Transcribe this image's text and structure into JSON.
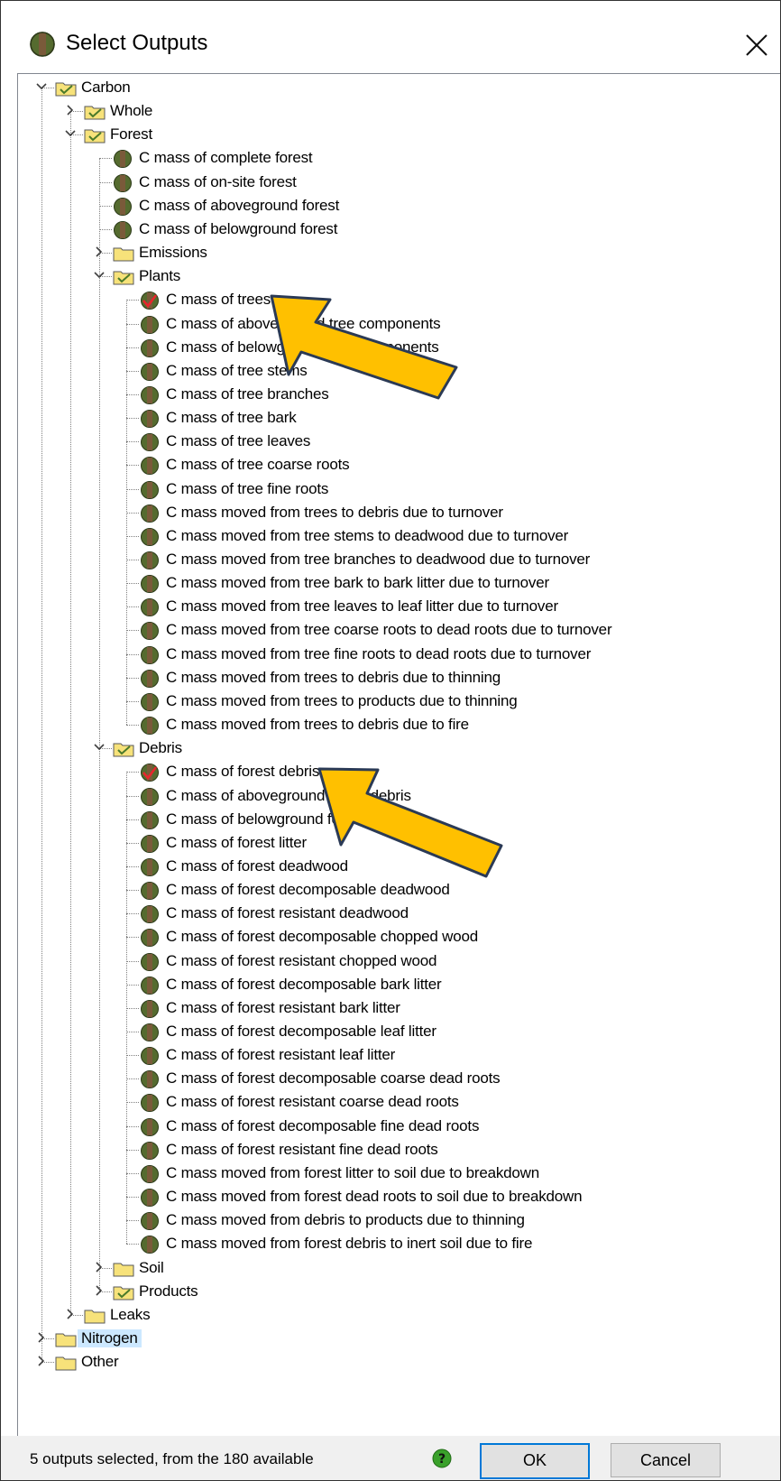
{
  "window": {
    "title": "Select Outputs",
    "icons": {
      "title": "pool-icon",
      "close": "close-icon"
    }
  },
  "tree": {
    "rows": [
      {
        "label": "Carbon",
        "depth": 0,
        "type": "folder",
        "state": "expanded",
        "checked": true
      },
      {
        "label": "Whole",
        "depth": 1,
        "type": "folder",
        "state": "collapsed",
        "checked": true
      },
      {
        "label": "Forest",
        "depth": 1,
        "type": "folder",
        "state": "expanded",
        "checked": true
      },
      {
        "label": "C mass of complete forest",
        "depth": 2,
        "type": "pool",
        "checked": false
      },
      {
        "label": "C mass of on-site forest",
        "depth": 2,
        "type": "pool",
        "checked": false
      },
      {
        "label": "C mass of aboveground forest",
        "depth": 2,
        "type": "pool",
        "checked": false
      },
      {
        "label": "C mass of belowground forest",
        "depth": 2,
        "type": "pool",
        "checked": false
      },
      {
        "label": "Emissions",
        "depth": 2,
        "type": "folder",
        "state": "collapsed",
        "checked": false
      },
      {
        "label": "Plants",
        "depth": 2,
        "type": "folder",
        "state": "expanded",
        "checked": true
      },
      {
        "label": "C mass of trees",
        "depth": 3,
        "type": "pool",
        "checked": true
      },
      {
        "label": "C mass of aboveground tree components",
        "depth": 3,
        "type": "pool",
        "checked": false
      },
      {
        "label": "C mass of belowground tree components",
        "depth": 3,
        "type": "pool",
        "checked": false
      },
      {
        "label": "C mass of tree stems",
        "depth": 3,
        "type": "pool",
        "checked": false
      },
      {
        "label": "C mass of tree branches",
        "depth": 3,
        "type": "pool",
        "checked": false
      },
      {
        "label": "C mass of tree bark",
        "depth": 3,
        "type": "pool",
        "checked": false
      },
      {
        "label": "C mass of tree leaves",
        "depth": 3,
        "type": "pool",
        "checked": false
      },
      {
        "label": "C mass of tree coarse roots",
        "depth": 3,
        "type": "pool",
        "checked": false
      },
      {
        "label": "C mass of tree fine roots",
        "depth": 3,
        "type": "pool",
        "checked": false
      },
      {
        "label": "C mass moved from trees to debris due to turnover",
        "depth": 3,
        "type": "pool",
        "checked": false
      },
      {
        "label": "C mass moved from tree stems to deadwood due to turnover",
        "depth": 3,
        "type": "pool",
        "checked": false
      },
      {
        "label": "C mass moved from tree branches to deadwood due to turnover",
        "depth": 3,
        "type": "pool",
        "checked": false
      },
      {
        "label": "C mass moved from tree bark to bark litter due to turnover",
        "depth": 3,
        "type": "pool",
        "checked": false
      },
      {
        "label": "C mass moved from tree leaves to leaf litter due to turnover",
        "depth": 3,
        "type": "pool",
        "checked": false
      },
      {
        "label": "C mass moved from tree coarse roots to dead roots due to turnover",
        "depth": 3,
        "type": "pool",
        "checked": false
      },
      {
        "label": "C mass moved from tree fine roots to dead roots due to turnover",
        "depth": 3,
        "type": "pool",
        "checked": false
      },
      {
        "label": "C mass moved from trees to debris due to thinning",
        "depth": 3,
        "type": "pool",
        "checked": false
      },
      {
        "label": "C mass moved from trees to products due to thinning",
        "depth": 3,
        "type": "pool",
        "checked": false
      },
      {
        "label": "C mass moved from trees to debris due to fire",
        "depth": 3,
        "type": "pool",
        "checked": false
      },
      {
        "label": "Debris",
        "depth": 2,
        "type": "folder",
        "state": "expanded",
        "checked": true
      },
      {
        "label": "C mass of forest debris",
        "depth": 3,
        "type": "pool",
        "checked": true
      },
      {
        "label": "C mass of aboveground forest debris",
        "depth": 3,
        "type": "pool",
        "checked": false
      },
      {
        "label": "C mass of belowground forest debris",
        "depth": 3,
        "type": "pool",
        "checked": false
      },
      {
        "label": "C mass of forest litter",
        "depth": 3,
        "type": "pool",
        "checked": false
      },
      {
        "label": "C mass of forest deadwood",
        "depth": 3,
        "type": "pool",
        "checked": false
      },
      {
        "label": "C mass of forest decomposable deadwood",
        "depth": 3,
        "type": "pool",
        "checked": false
      },
      {
        "label": "C mass of forest resistant deadwood",
        "depth": 3,
        "type": "pool",
        "checked": false
      },
      {
        "label": "C mass of forest decomposable chopped wood",
        "depth": 3,
        "type": "pool",
        "checked": false
      },
      {
        "label": "C mass of forest resistant chopped wood",
        "depth": 3,
        "type": "pool",
        "checked": false
      },
      {
        "label": "C mass of forest decomposable bark litter",
        "depth": 3,
        "type": "pool",
        "checked": false
      },
      {
        "label": "C mass of forest resistant bark litter",
        "depth": 3,
        "type": "pool",
        "checked": false
      },
      {
        "label": "C mass of forest decomposable leaf litter",
        "depth": 3,
        "type": "pool",
        "checked": false
      },
      {
        "label": "C mass of forest resistant leaf litter",
        "depth": 3,
        "type": "pool",
        "checked": false
      },
      {
        "label": "C mass of forest decomposable coarse dead roots",
        "depth": 3,
        "type": "pool",
        "checked": false
      },
      {
        "label": "C mass of forest resistant coarse dead roots",
        "depth": 3,
        "type": "pool",
        "checked": false
      },
      {
        "label": "C mass of forest decomposable fine dead roots",
        "depth": 3,
        "type": "pool",
        "checked": false
      },
      {
        "label": "C mass of forest resistant fine dead roots",
        "depth": 3,
        "type": "pool",
        "checked": false
      },
      {
        "label": "C mass moved from forest litter to soil due to breakdown",
        "depth": 3,
        "type": "pool",
        "checked": false
      },
      {
        "label": "C mass moved from forest dead roots to soil due to breakdown",
        "depth": 3,
        "type": "pool",
        "checked": false
      },
      {
        "label": "C mass moved from debris to products due to thinning",
        "depth": 3,
        "type": "pool",
        "checked": false
      },
      {
        "label": "C mass moved from forest debris to inert soil due to fire",
        "depth": 3,
        "type": "pool",
        "checked": false
      },
      {
        "label": "Soil",
        "depth": 2,
        "type": "folder",
        "state": "collapsed",
        "checked": false
      },
      {
        "label": "Products",
        "depth": 2,
        "type": "folder",
        "state": "collapsed",
        "checked": true
      },
      {
        "label": "Leaks",
        "depth": 1,
        "type": "folder",
        "state": "collapsed",
        "checked": false
      },
      {
        "label": "Nitrogen",
        "depth": 0,
        "type": "folder",
        "state": "collapsed",
        "checked": false,
        "selected": true
      },
      {
        "label": "Other",
        "depth": 0,
        "type": "folder",
        "state": "collapsed",
        "checked": false
      }
    ]
  },
  "annotations": {
    "arrows": [
      {
        "target": "C mass of trees",
        "color": "#ffc000"
      },
      {
        "target": "C mass of forest debris",
        "color": "#ffc000"
      }
    ]
  },
  "status": {
    "text": "5 outputs selected, from the 180 available",
    "help_icon": "help-icon"
  },
  "buttons": {
    "ok": "OK",
    "cancel": "Cancel"
  },
  "colors": {
    "selection": "#cce8ff",
    "folder": "#f7e27a",
    "arrow": "#ffc000",
    "ok_border": "#0078d7",
    "check": "#e8262d"
  }
}
